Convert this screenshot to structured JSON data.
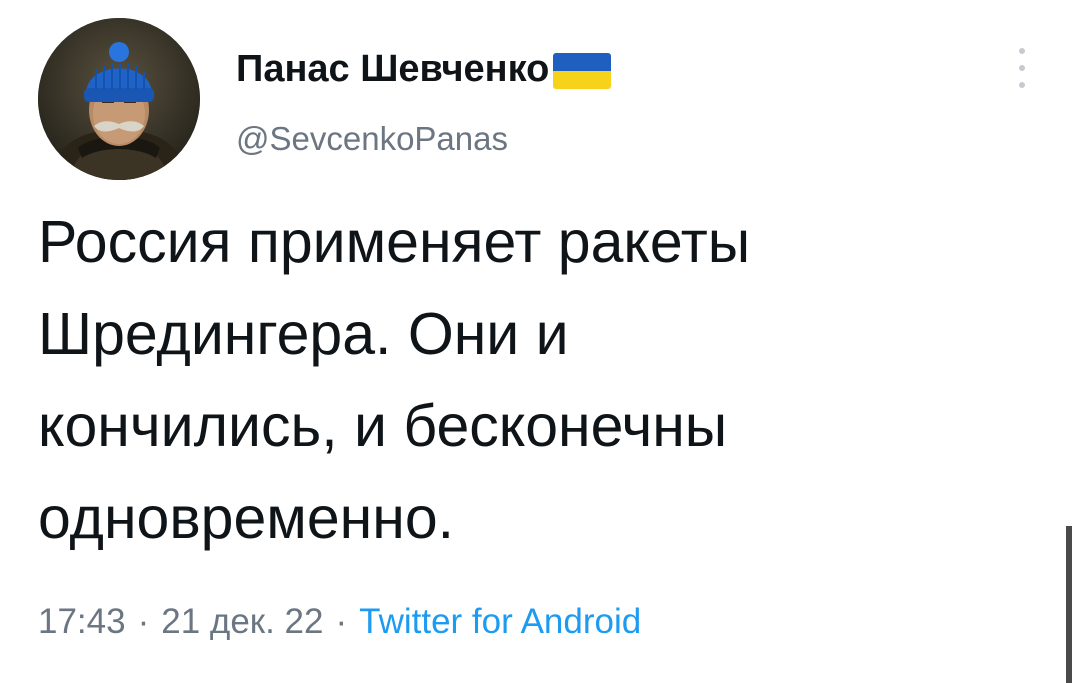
{
  "author": {
    "display_name": "Панас Шевченко",
    "handle": "@SevcenkoPanas",
    "avatar_icon": "portrait-avatar",
    "flag_icon": "ukraine-flag-icon",
    "flag_colors": {
      "top": "#1f5fbf",
      "bottom": "#f7d21b"
    }
  },
  "tweet": {
    "text": "Россия применяет ракеты\nШредингера. Они и\nкончились, и бесконечны\nодновременно."
  },
  "meta": {
    "time": "17:43",
    "separator": "·",
    "date": "21 дек. 22",
    "source": "Twitter for Android"
  },
  "colors": {
    "text": "#0f1419",
    "secondary": "#6b7682",
    "link": "#1d9bf0"
  }
}
